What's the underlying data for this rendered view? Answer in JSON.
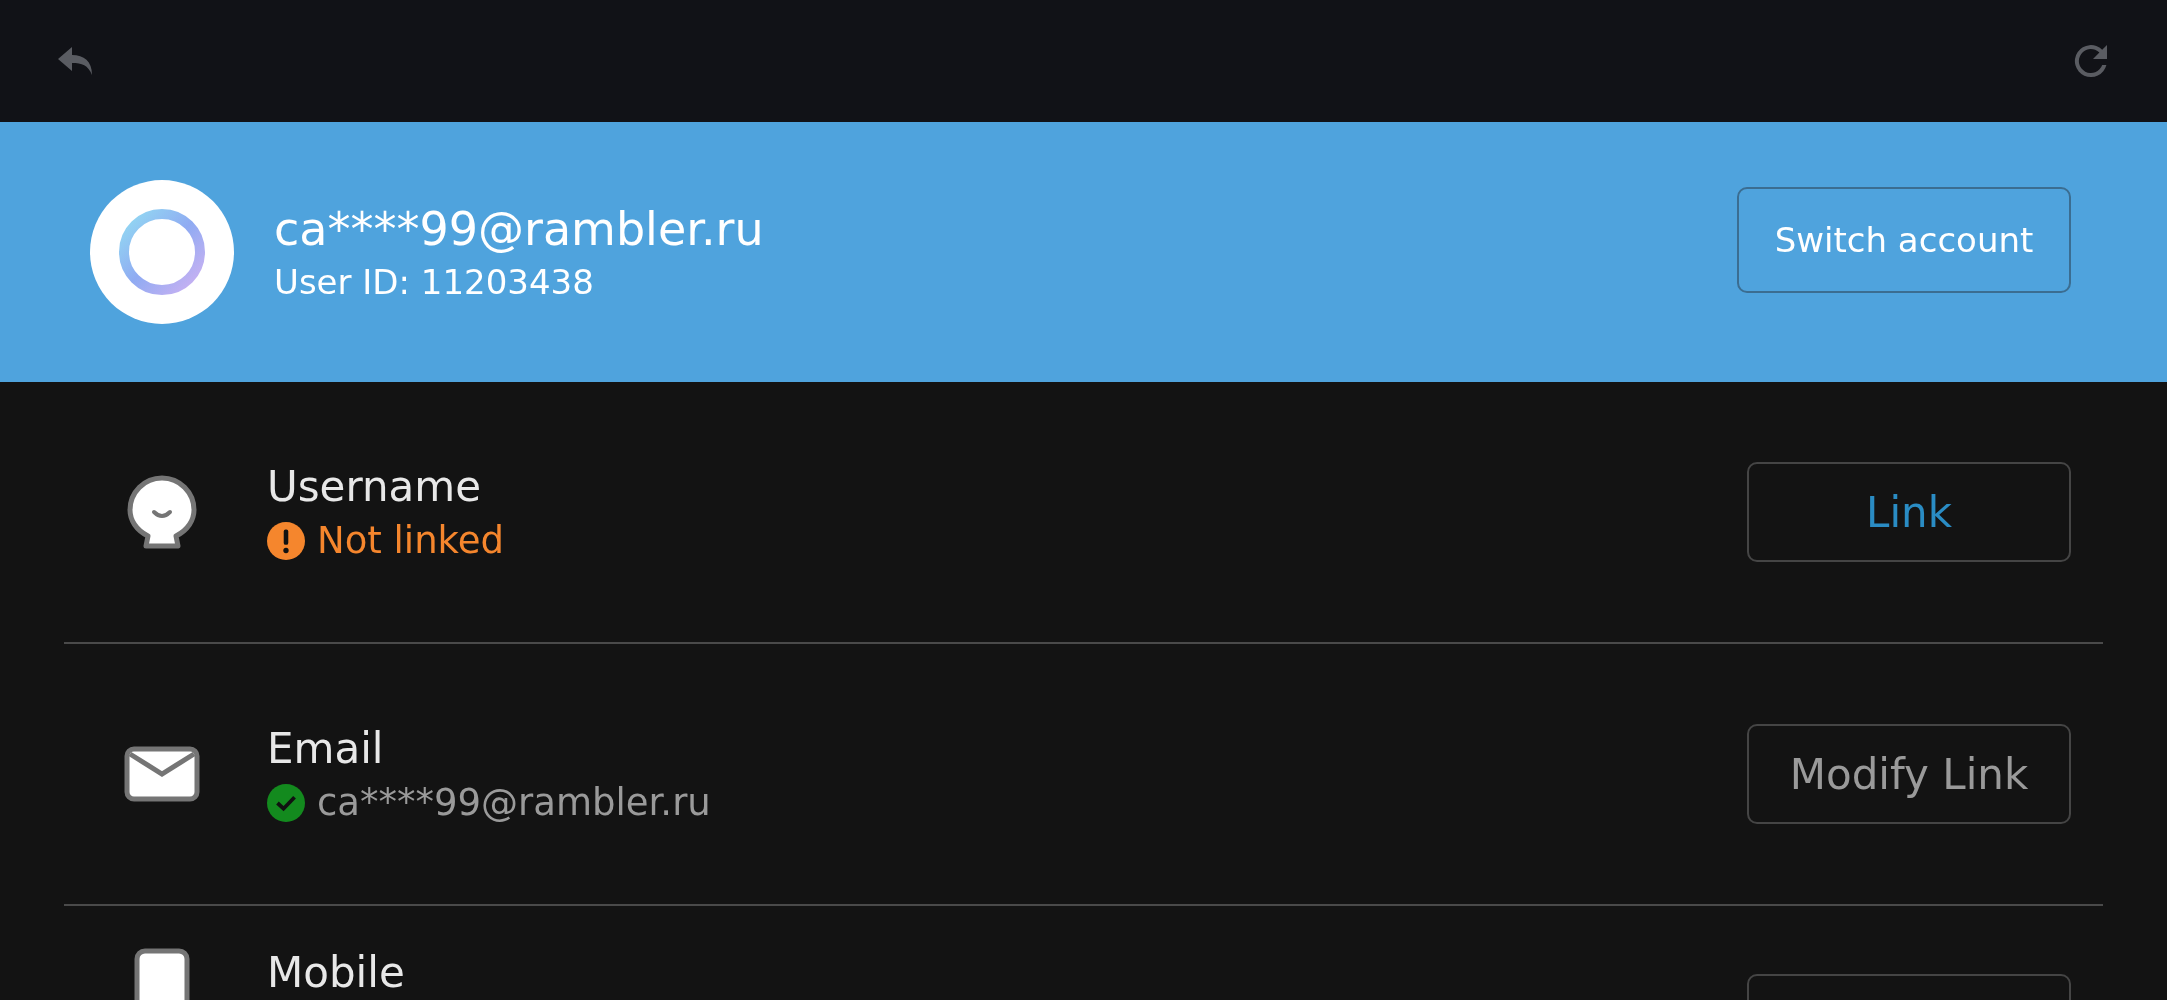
{
  "account": {
    "email": "ca****99@rambler.ru",
    "user_id": "User ID: 11203438",
    "switch_button": "Switch account"
  },
  "rows": [
    {
      "kind": "user",
      "title": "Username",
      "status": {
        "kind": "warning",
        "text": "Not linked"
      },
      "button": {
        "kind": "primary",
        "label": "Link"
      }
    },
    {
      "kind": "mail",
      "title": "Email",
      "status": {
        "kind": "linked",
        "text": "ca****99@rambler.ru"
      },
      "button": {
        "kind": "secondary",
        "label": "Modify Link"
      }
    },
    {
      "kind": "phone",
      "title": "Mobile"
    }
  ]
}
